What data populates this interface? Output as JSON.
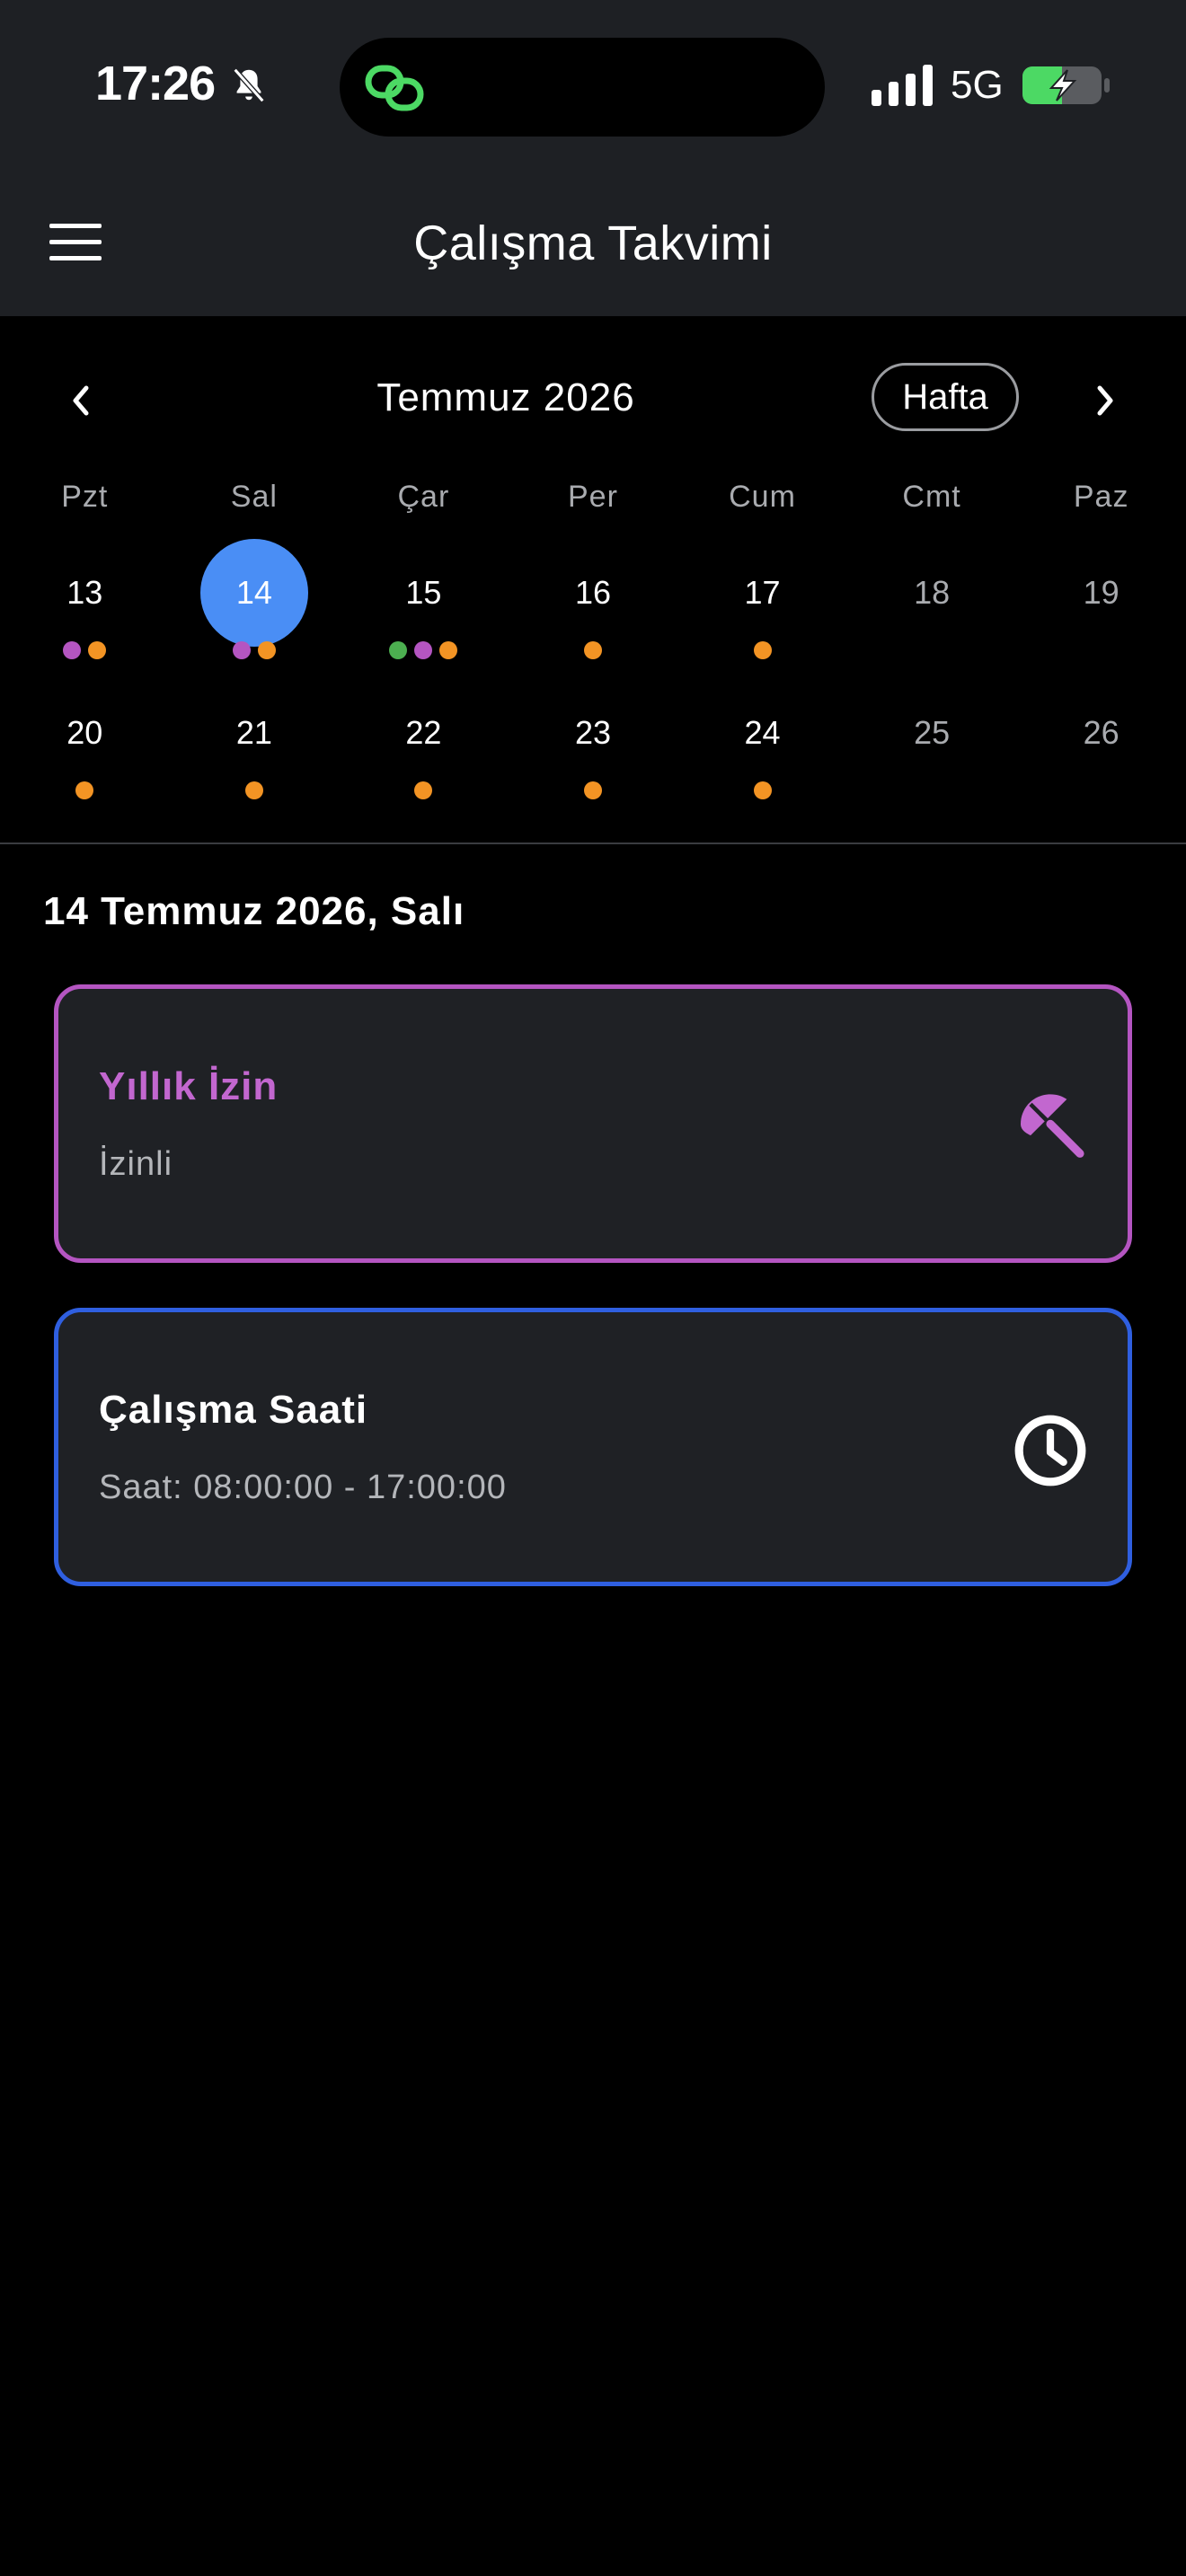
{
  "status_bar": {
    "time": "17:26",
    "network": "5G"
  },
  "app_bar": {
    "title": "Çalışma Takvimi"
  },
  "calendar": {
    "month_title": "Temmuz 2026",
    "view_toggle": "Hafta",
    "weekdays": [
      "Pzt",
      "Sal",
      "Çar",
      "Per",
      "Cum",
      "Cmt",
      "Paz"
    ],
    "weeks": [
      [
        {
          "day": "13",
          "dots": [
            "#b455c1",
            "#f39424"
          ]
        },
        {
          "day": "14",
          "selected": true,
          "dots": [
            "#b455c1",
            "#f39424"
          ]
        },
        {
          "day": "15",
          "dots": [
            "#4caf50",
            "#b455c1",
            "#f39424"
          ]
        },
        {
          "day": "16",
          "dots": [
            "#f39424"
          ]
        },
        {
          "day": "17",
          "dots": [
            "#f39424"
          ]
        },
        {
          "day": "18",
          "weekend": true,
          "dots": []
        },
        {
          "day": "19",
          "weekend": true,
          "dots": []
        }
      ],
      [
        {
          "day": "20",
          "dots": [
            "#f39424"
          ]
        },
        {
          "day": "21",
          "dots": [
            "#f39424"
          ]
        },
        {
          "day": "22",
          "dots": [
            "#f39424"
          ]
        },
        {
          "day": "23",
          "dots": [
            "#f39424"
          ]
        },
        {
          "day": "24",
          "dots": [
            "#f39424"
          ]
        },
        {
          "day": "25",
          "weekend": true,
          "dots": []
        },
        {
          "day": "26",
          "weekend": true,
          "dots": []
        }
      ]
    ]
  },
  "selected_date_label": "14 Temmuz 2026, Salı",
  "events": {
    "leave": {
      "title": "Yıllık İzin",
      "subtitle": "İzinli",
      "icon": "umbrella-icon",
      "color": "#b455c1"
    },
    "work": {
      "title": "Çalışma Saati",
      "subtitle": "Saat: 08:00:00 - 17:00:00",
      "icon": "clock-icon",
      "color": "#2f5fe0"
    }
  },
  "colors": {
    "selected_day": "#4a8ef5",
    "leave_dot": "#b455c1",
    "work_dot": "#f39424",
    "holiday_dot": "#4caf50"
  }
}
